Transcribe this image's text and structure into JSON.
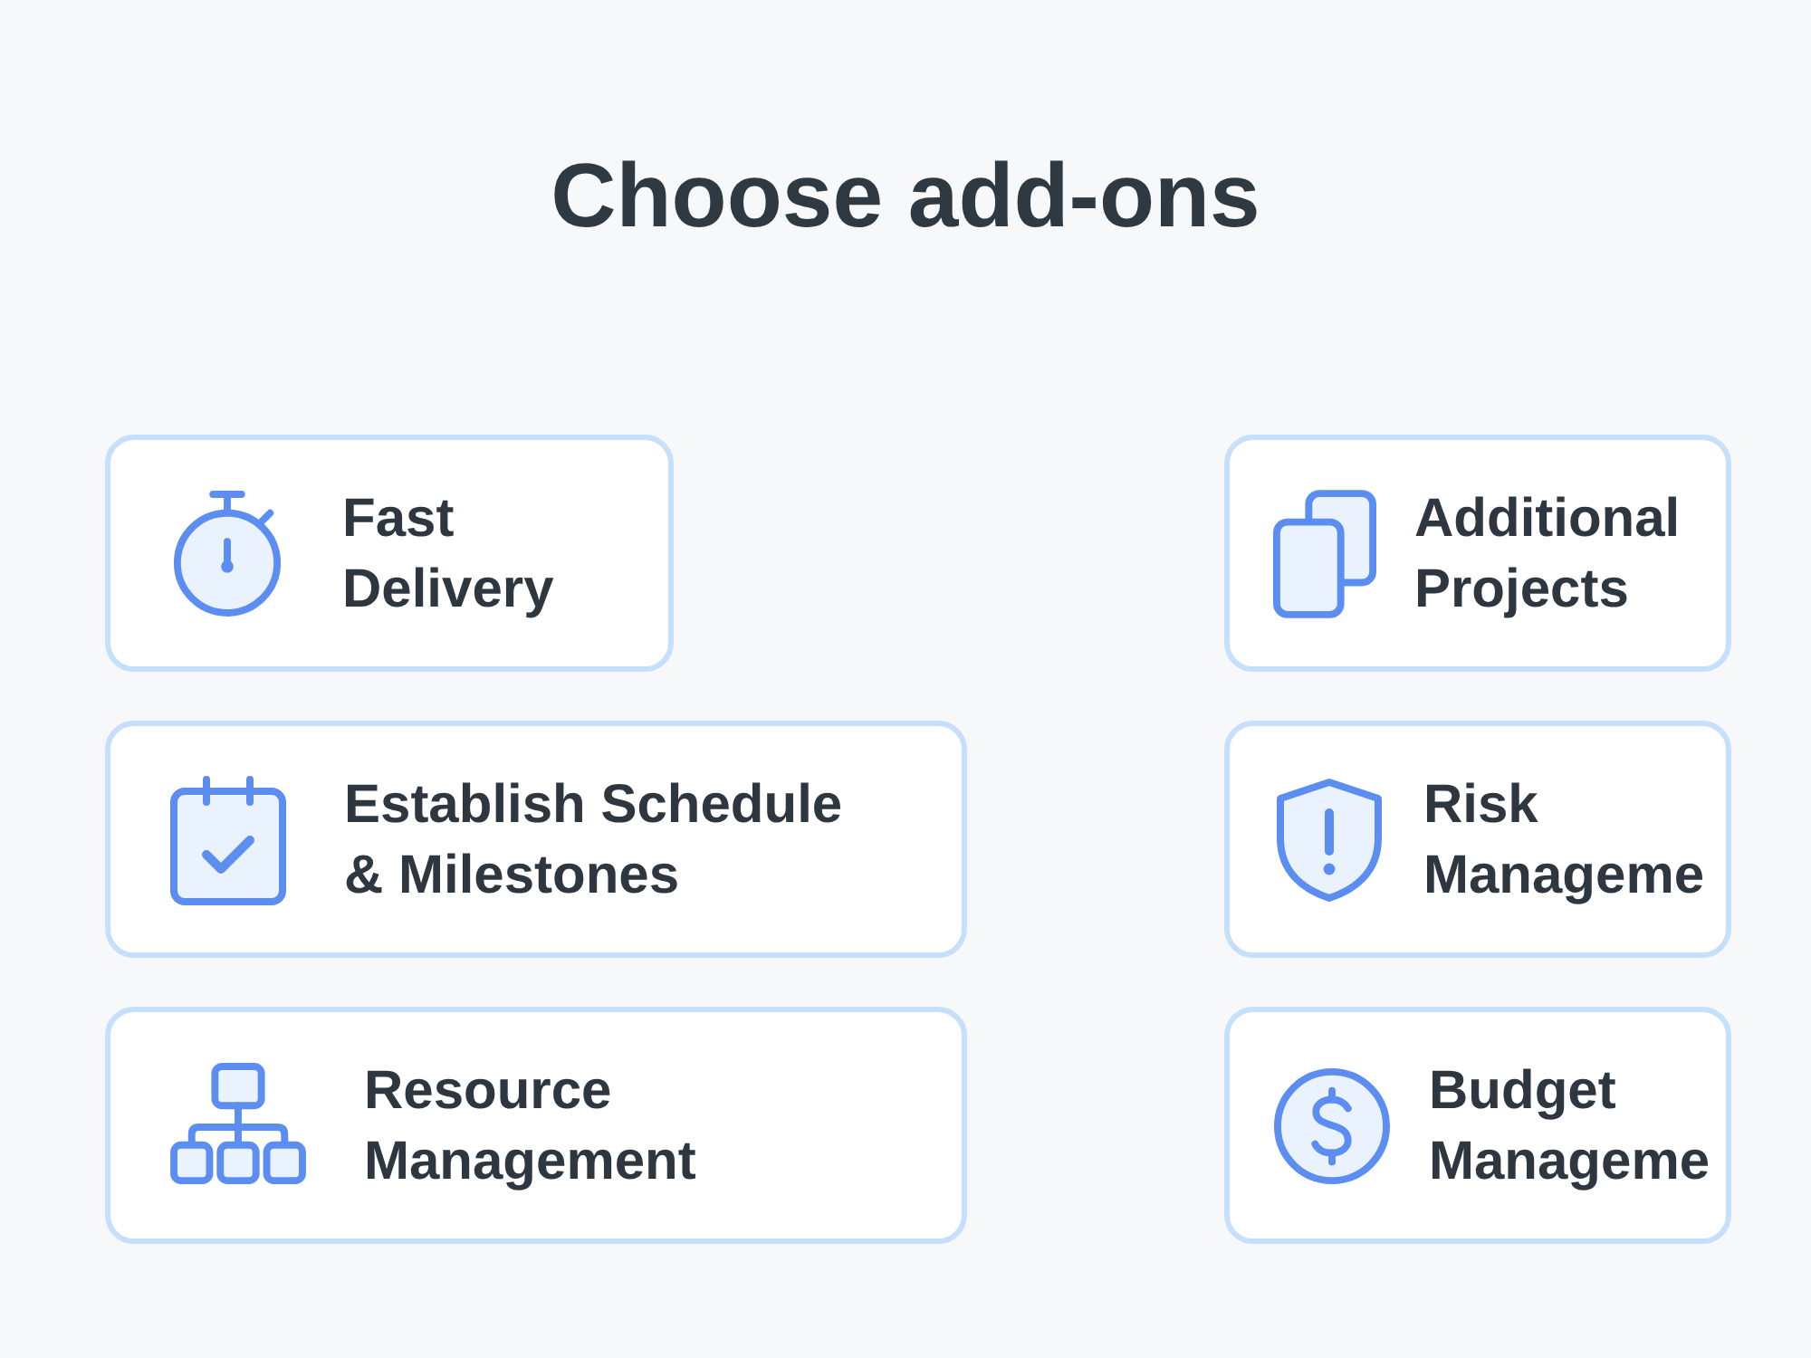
{
  "title": "Choose add-ons",
  "left_column": [
    {
      "kind": "stopwatch",
      "label": "Fast Delivery"
    },
    {
      "kind": "calendar",
      "label": "Establish Schedule & Milestones"
    },
    {
      "kind": "hierarchy",
      "label": "Resource Management"
    }
  ],
  "right_column": [
    {
      "kind": "pages",
      "label": "Additional Projects"
    },
    {
      "kind": "shield",
      "label": "Risk Manageme"
    },
    {
      "kind": "dollar",
      "label": "Budget Manageme"
    }
  ]
}
